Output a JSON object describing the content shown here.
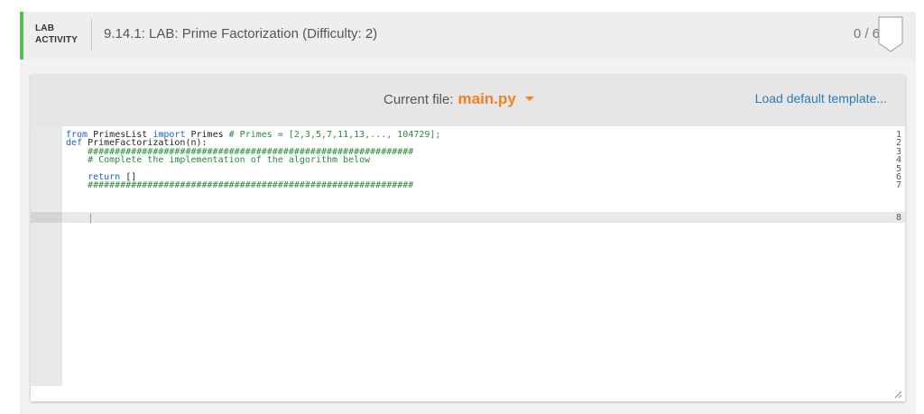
{
  "header": {
    "tag_line1": "LAB",
    "tag_line2": "ACTIVITY",
    "title": "9.14.1: LAB: Prime Factorization (Difficulty: 2)",
    "score": "0 / 6"
  },
  "file_bar": {
    "current_file_label": "Current file:",
    "file_name": "main.py",
    "load_template": "Load default template..."
  },
  "editor": {
    "line_numbers": [
      "1",
      "2",
      "3",
      "4",
      "5",
      "6",
      "7",
      "8"
    ],
    "lines": {
      "l1_kw1": "from",
      "l1_mod": " PrimesList ",
      "l1_kw2": "import",
      "l1_name": " Primes ",
      "l1_comment": "# Primes = [2,3,5,7,11,13,..., 104729];",
      "l2_kw": "def",
      "l2_rest": " PrimeFactorization(n):",
      "l3": "    ############################################################",
      "l4": "    # Complete the implementation of the algorithm below",
      "l5": "",
      "l6_indent": "    ",
      "l6_kw": "return",
      "l6_rest": " []",
      "l7": "    ############################################################",
      "l8": ""
    },
    "active_line": 8
  },
  "colors": {
    "accent_green": "#5cb85c",
    "file_orange": "#f57f20",
    "link_blue": "#2b7bb9",
    "keyword_blue": "#1a5ec6",
    "comment_green": "#2a8a3a"
  }
}
